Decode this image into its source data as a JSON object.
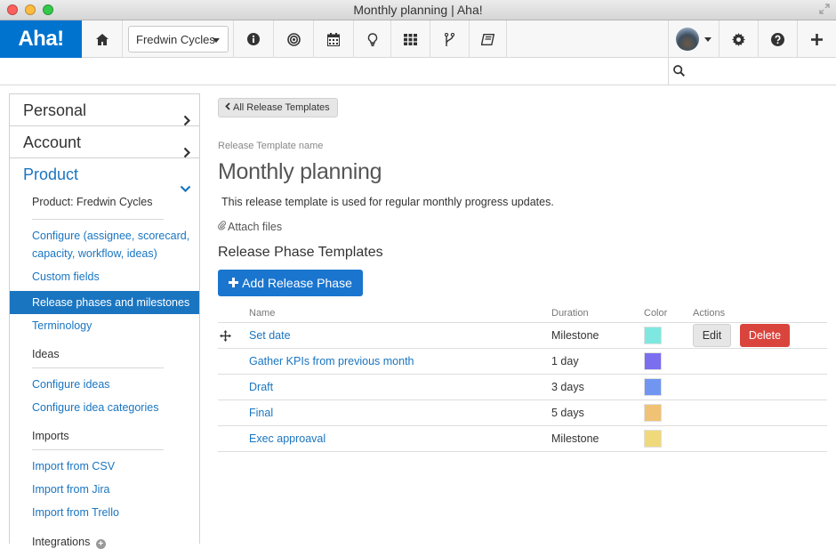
{
  "window": {
    "title": "Monthly planning | Aha!"
  },
  "topnav": {
    "logo": "Aha!",
    "product_selector": "Fredwin Cycles",
    "icons": [
      "home-icon",
      "info-icon",
      "target-icon",
      "calendar-icon",
      "lightbulb-icon",
      "grid-icon",
      "branch-icon",
      "book-icon",
      "avatar",
      "gear-icon",
      "help-icon",
      "plus-icon"
    ]
  },
  "search": {
    "value": "",
    "placeholder": ""
  },
  "sidebar": {
    "sections": [
      {
        "label": "Personal"
      },
      {
        "label": "Account"
      },
      {
        "label": "Product"
      }
    ],
    "product_sub": "Product: Fredwin Cycles",
    "configure": "Configure (assignee, scorecard, capacity, workflow, ideas)",
    "custom_fields": "Custom fields",
    "release_phases": "Release phases and milestones",
    "terminology": "Terminology",
    "ideas_title": "Ideas",
    "configure_ideas": "Configure ideas",
    "configure_idea_categories": "Configure idea categories",
    "imports_title": "Imports",
    "import_csv": "Import from CSV",
    "import_jira": "Import from Jira",
    "import_trello": "Import from Trello",
    "integrations_title": "Integrations"
  },
  "main": {
    "back_button": "All Release Templates",
    "field_label": "Release Template name",
    "template_name": "Monthly planning",
    "description": "This release template is used for regular monthly progress updates.",
    "attach_files": "Attach files",
    "section_title": "Release Phase Templates",
    "add_button": "Add Release Phase",
    "table": {
      "headers": {
        "name": "Name",
        "duration": "Duration",
        "color": "Color",
        "actions": "Actions"
      },
      "rows": [
        {
          "name": "Set date",
          "duration": "Milestone",
          "color": "#7ee8e0"
        },
        {
          "name": "Gather KPIs from previous month",
          "duration": "1 day",
          "color": "#7b6ff0"
        },
        {
          "name": "Draft",
          "duration": "3 days",
          "color": "#7196f2"
        },
        {
          "name": "Final",
          "duration": "5 days",
          "color": "#f0c275"
        },
        {
          "name": "Exec approaval",
          "duration": "Milestone",
          "color": "#f0d97a"
        }
      ],
      "edit_label": "Edit",
      "delete_label": "Delete"
    }
  }
}
